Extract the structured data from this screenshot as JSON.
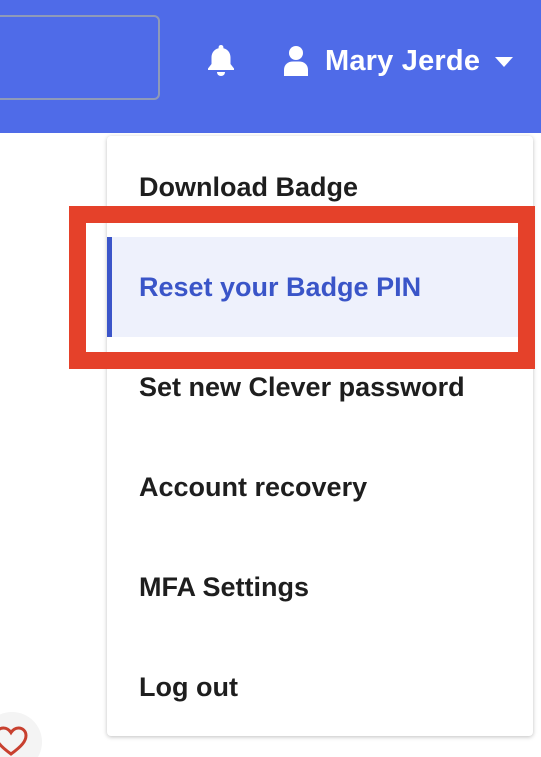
{
  "header": {
    "user_name": "Mary Jerde",
    "icons": {
      "notifications": "bell-icon",
      "user": "user-icon",
      "dropdown": "caret-down-icon"
    },
    "colors": {
      "bar": "#4f6be8",
      "text": "#ffffff"
    }
  },
  "menu": {
    "items": [
      {
        "label": "Download Badge",
        "active": false
      },
      {
        "label": "Reset your Badge PIN",
        "active": true
      },
      {
        "label": "Set new Clever password",
        "active": false
      },
      {
        "label": "Account recovery",
        "active": false
      },
      {
        "label": "MFA Settings",
        "active": false
      },
      {
        "label": "Log out",
        "active": false
      }
    ],
    "colors": {
      "active_text": "#3a55c8",
      "active_bg": "#eef1fc",
      "text": "#1e1e1e"
    }
  },
  "annotation": {
    "highlight_color": "#e5412a"
  },
  "footer": {
    "icon": "heart-icon"
  }
}
